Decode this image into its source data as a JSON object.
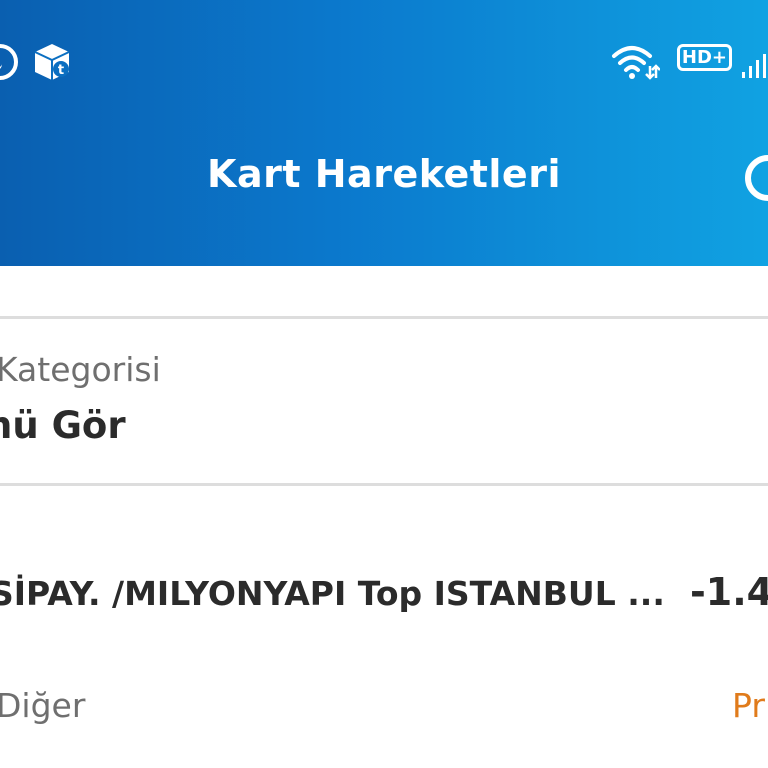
{
  "status_bar": {
    "left_icons": [
      "smiley-face-icon",
      "box-icon"
    ],
    "network_label": "HD+",
    "right_icons": [
      "wifi-icon",
      "signal-icon"
    ]
  },
  "header": {
    "title": "Kart Hareketleri",
    "search_icon": "search-icon",
    "gradient_start": "#0a5fb0",
    "gradient_end": "#10a2e2"
  },
  "category_filter": {
    "label": "Kategorisi",
    "value": "nü Gör"
  },
  "transactions": [
    {
      "description": "SİPAY. /MILYONYAPI Top ISTANBUL ...",
      "amount": "-1.4",
      "category": "Diğer",
      "status": "Pr",
      "status_color": "#e07b1b"
    }
  ]
}
